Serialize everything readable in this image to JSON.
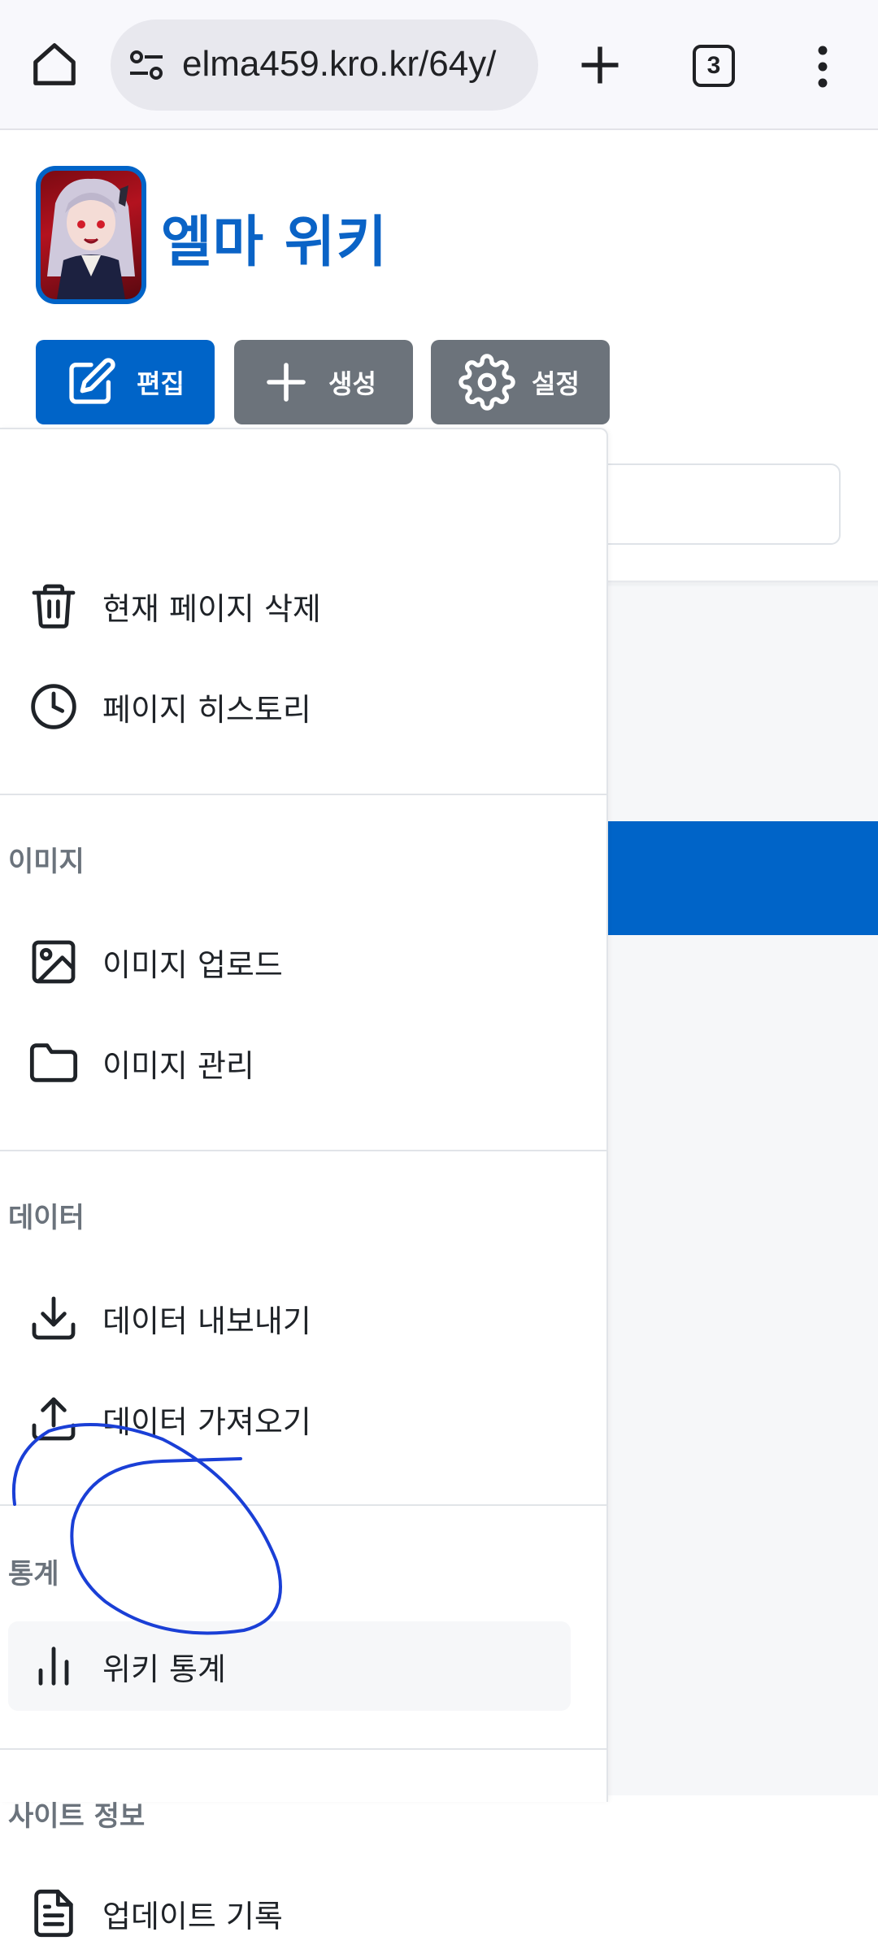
{
  "browser": {
    "url": "elma459.kro.kr/64y/",
    "tab_count": "3"
  },
  "site": {
    "title": "엘마 위키"
  },
  "actions": {
    "edit": "편집",
    "create": "생성",
    "settings": "설정"
  },
  "menu": {
    "page_items": [
      {
        "label": "현재 페이지 삭제",
        "icon": "trash-icon"
      },
      {
        "label": "페이지 히스토리",
        "icon": "clock-icon"
      }
    ],
    "image_section": {
      "title": "이미지",
      "items": [
        {
          "label": "이미지 업로드",
          "icon": "image-icon"
        },
        {
          "label": "이미지 관리",
          "icon": "folder-icon"
        }
      ]
    },
    "data_section": {
      "title": "데이터",
      "items": [
        {
          "label": "데이터 내보내기",
          "icon": "download-icon"
        },
        {
          "label": "데이터 가져오기",
          "icon": "upload-icon"
        }
      ]
    },
    "stats_section": {
      "title": "통계",
      "items": [
        {
          "label": "위키 통계",
          "icon": "bar-chart-icon"
        }
      ]
    },
    "site_info_section": {
      "title": "사이트 정보",
      "items": [
        {
          "label": "업데이트 기록",
          "icon": "document-icon"
        }
      ]
    }
  },
  "colors": {
    "primary": "#0064c8",
    "secondary_button": "#6c737b",
    "annotation_pen": "#1a3fd6"
  }
}
